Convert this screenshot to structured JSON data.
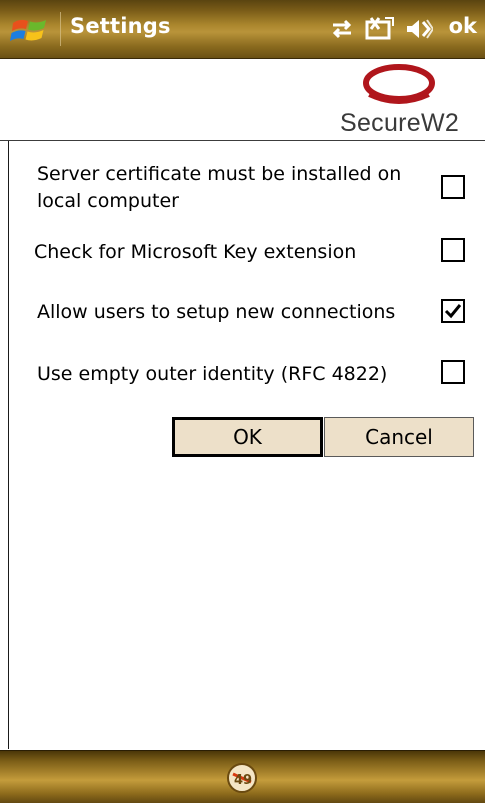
{
  "titlebar": {
    "title": "Settings",
    "ok_label": "ok",
    "icons": [
      "windows-start-icon",
      "connectivity-icon",
      "network-icon",
      "volume-icon"
    ]
  },
  "logo": {
    "text": "SecureW2",
    "ring_color": "#b0161c"
  },
  "options": [
    {
      "label_line1": "Server certificate must be installed on",
      "label_line2": "local computer",
      "checked": false
    },
    {
      "label": "Check for Microsoft Key extension",
      "checked": false
    },
    {
      "label": "Allow users to setup new connections",
      "checked": true
    },
    {
      "label": "Use empty outer identity (RFC 4822)",
      "checked": false
    }
  ],
  "buttons": {
    "ok_label": "OK",
    "cancel_label": "Cancel"
  },
  "bottombar": {
    "sip_icon": "keyboard-input-icon"
  },
  "colors": {
    "bar_gold": "#b9943a",
    "button_bg": "#ede0c9",
    "logo_red": "#b0161c"
  }
}
